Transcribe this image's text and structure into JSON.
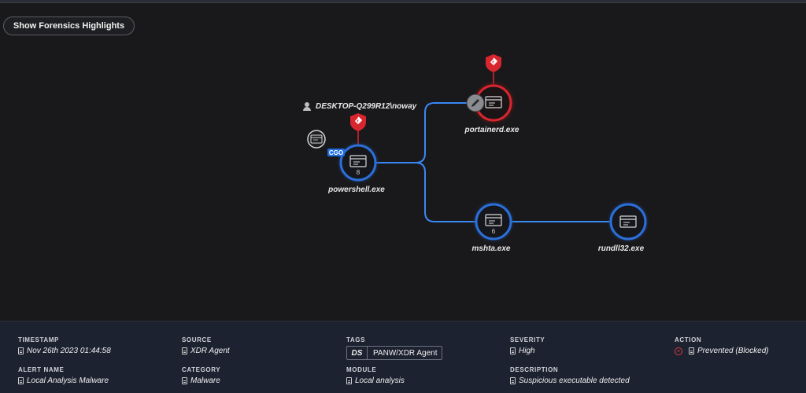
{
  "toolbar": {
    "forensics_button": "Show Forensics Highlights"
  },
  "graph": {
    "user": "DESKTOP-Q299R12\\noway",
    "badge": "CGO",
    "nodes": [
      {
        "id": "powershell",
        "label": "powershell.exe",
        "count": "8",
        "state": "normal"
      },
      {
        "id": "portainerd",
        "label": "portainerd.exe",
        "count": "",
        "state": "alert"
      },
      {
        "id": "mshta",
        "label": "mshta.exe",
        "count": "6",
        "state": "normal"
      },
      {
        "id": "rundll32",
        "label": "rundll32.exe",
        "count": "",
        "state": "normal"
      }
    ]
  },
  "colors": {
    "edge": "#3a87f5",
    "ring": "#2c6fd9",
    "alert": "#d8262f",
    "background": "#19191b",
    "panel": "#1d2230"
  },
  "details": {
    "timestamp": {
      "label": "TIMESTAMP",
      "value": "Nov 26th 2023 01:44:58"
    },
    "source": {
      "label": "SOURCE",
      "value": "XDR Agent"
    },
    "tags": {
      "label": "TAGS",
      "prefix": "DS",
      "value": "PANW/XDR Agent"
    },
    "severity": {
      "label": "SEVERITY",
      "value": "High"
    },
    "action": {
      "label": "ACTION",
      "value": "Prevented (Blocked)"
    },
    "alert_name": {
      "label": "ALERT NAME",
      "value": "Local Analysis Malware"
    },
    "category": {
      "label": "CATEGORY",
      "value": "Malware"
    },
    "module": {
      "label": "MODULE",
      "value": "Local analysis"
    },
    "description": {
      "label": "DESCRIPTION",
      "value": "Suspicious executable detected"
    }
  }
}
